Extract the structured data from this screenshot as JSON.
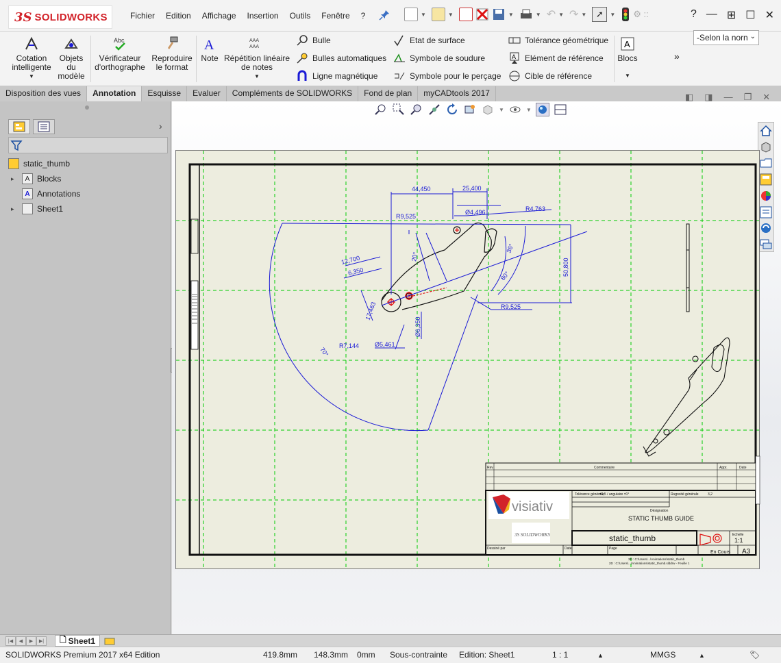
{
  "app": {
    "logo_prefix": "3S",
    "logo_text": "SOLIDWORKS",
    "menu": [
      "Fichier",
      "Edition",
      "Affichage",
      "Insertion",
      "Outils",
      "Fenêtre",
      "?"
    ],
    "search_glyph": "?"
  },
  "ribbon": {
    "big_buttons": [
      {
        "label": "Cotation intelligente",
        "icon": "smart-dimension-icon"
      },
      {
        "label": "Objets du modèle",
        "icon": "model-items-icon"
      },
      {
        "label": "Vérificateur d'orthographe",
        "icon": "spell-checker-icon"
      },
      {
        "label": "Reproduire le format",
        "icon": "format-painter-icon"
      },
      {
        "label": "Note",
        "icon": "note-icon"
      },
      {
        "label": "Répétition linéaire de notes",
        "icon": "linear-note-pattern-icon"
      }
    ],
    "small_col1": [
      "Bulle",
      "Bulles automatiques",
      "Ligne magnétique"
    ],
    "small_col2": [
      "Etat de surface",
      "Symbole de soudure",
      "Symbole pour le perçage"
    ],
    "small_col3": [
      "Tolérance géométrique",
      "Elément de référence",
      "Cible de référence"
    ],
    "blocs_label": "Blocs",
    "overflow": "»",
    "standard_dropdown": "-Selon la norn"
  },
  "command_tabs": [
    {
      "label": "Disposition des vues",
      "active": false
    },
    {
      "label": "Annotation",
      "active": true
    },
    {
      "label": "Esquisse",
      "active": false
    },
    {
      "label": "Evaluer",
      "active": false
    },
    {
      "label": "Compléments de SOLIDWORKS",
      "active": false
    },
    {
      "label": "Fond de plan",
      "active": false
    },
    {
      "label": "myCADtools 2017",
      "active": false
    }
  ],
  "tree": {
    "root": "static_thumb",
    "items": [
      {
        "label": "Blocks",
        "expandable": true
      },
      {
        "label": "Annotations",
        "expandable": false
      },
      {
        "label": "Sheet1",
        "expandable": true
      }
    ]
  },
  "drawing": {
    "dimensions": [
      "44,450",
      "25,400",
      "R9,525",
      "Ø4,496",
      "R4,763",
      "12,700",
      "6,350",
      "20°",
      "36°",
      "80°",
      "50,800",
      "17,463",
      "R9,525",
      "Ø6,350",
      "R7,144",
      "Ø5,461",
      "70°"
    ],
    "title_block": {
      "company": "visiativ",
      "title": "STATIC THUMB GUIDE",
      "part_name": "static_thumb",
      "scale_label": "Echelle",
      "scale": "1:1",
      "sheet_format": "A3",
      "revision_header": "Commentaire",
      "designer_label": "Désignation",
      "drawn_by_label": "Dessiné par",
      "date_label": "Date",
      "page_label": "Page",
      "status": "En Cours",
      "stamp": "3S SOLIDWORKS",
      "general_tolerance_label": "Tolérance générale",
      "general_tolerance": "±0,5 / angulaire ±1°",
      "roughness_label": "Rugosité générale",
      "roughness": "3,2",
      "rev_label": "Rev",
      "approved_label": "Appr.",
      "date_col_label": "Date"
    },
    "file_path_1": "3D : C:\\Users\\...\\Animations\\static_thumb",
    "file_path_2": "2D : C:\\Users\\...\\Animations\\static_thumb.slddrw - Feuille 1"
  },
  "sheet_tab": "Sheet1",
  "status": {
    "edition": "SOLIDWORKS Premium 2017 x64 Edition",
    "x": "419.8mm",
    "y": "148.3mm",
    "z": "0mm",
    "state": "Sous-contrainte",
    "editing": "Edition: Sheet1",
    "scale": "1 : 1",
    "units": "MMGS"
  },
  "colors": {
    "brand_red": "#d2232a",
    "dimension_blue": "#1a1ad6",
    "grid_green": "#00cc00",
    "sheet_bg": "#ededdf"
  }
}
